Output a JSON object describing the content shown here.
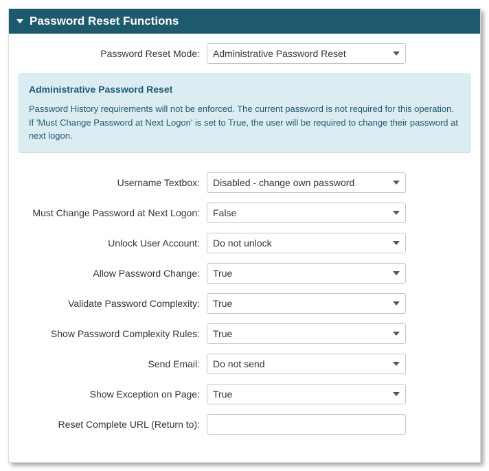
{
  "panel": {
    "title": "Password Reset Functions"
  },
  "modeRow": {
    "label": "Password Reset Mode:",
    "value": "Administrative Password Reset"
  },
  "info": {
    "title": "Administrative Password Reset",
    "body": "Password History requirements will not be enforced. The current password is not required for this operation. If 'Must Change Password at Next Logon' is set to True, the user will be required to change their password at next logon."
  },
  "fields": {
    "usernameTextbox": {
      "label": "Username Textbox:",
      "value": "Disabled - change own password"
    },
    "mustChange": {
      "label": "Must Change Password at Next Logon:",
      "value": "False"
    },
    "unlock": {
      "label": "Unlock User Account:",
      "value": "Do not unlock"
    },
    "allowChange": {
      "label": "Allow Password Change:",
      "value": "True"
    },
    "validateComplexity": {
      "label": "Validate Password Complexity:",
      "value": "True"
    },
    "showComplexityRules": {
      "label": "Show Password Complexity Rules:",
      "value": "True"
    },
    "sendEmail": {
      "label": "Send Email:",
      "value": "Do not send"
    },
    "showException": {
      "label": "Show Exception on Page:",
      "value": "True"
    },
    "resetUrl": {
      "label": "Reset Complete URL (Return to):",
      "value": ""
    }
  }
}
